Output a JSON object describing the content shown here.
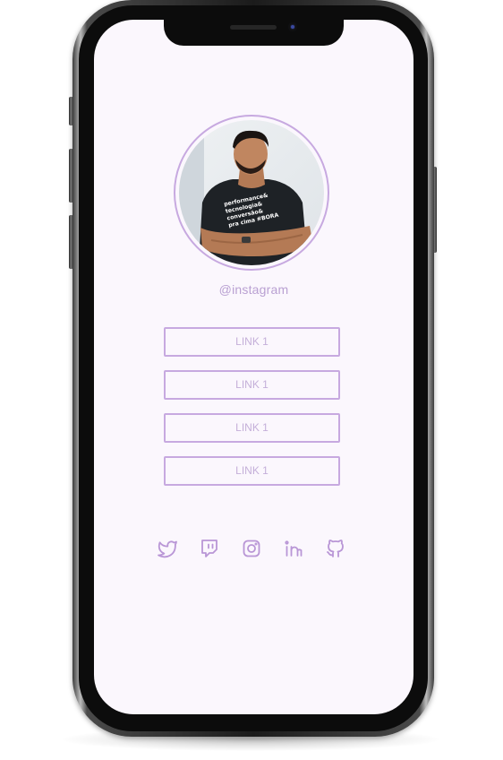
{
  "profile": {
    "handle": "@instagram",
    "shirt_text": [
      "performance&",
      "tecnologia&",
      "conversão&",
      "pra cima #BORA"
    ]
  },
  "links": [
    {
      "label": "LINK 1"
    },
    {
      "label": "LINK 1"
    },
    {
      "label": "LINK 1"
    },
    {
      "label": "LINK 1"
    }
  ],
  "social_icons": [
    "twitter-icon",
    "twitch-icon",
    "instagram-icon",
    "linkedin-icon",
    "github-icon"
  ],
  "colors": {
    "accent": "#c7a9e0",
    "text_accent": "#b9a0d2",
    "icon": "#b996d6",
    "screen_bg": "#fbf7fd",
    "device": "#1b1b1b"
  }
}
